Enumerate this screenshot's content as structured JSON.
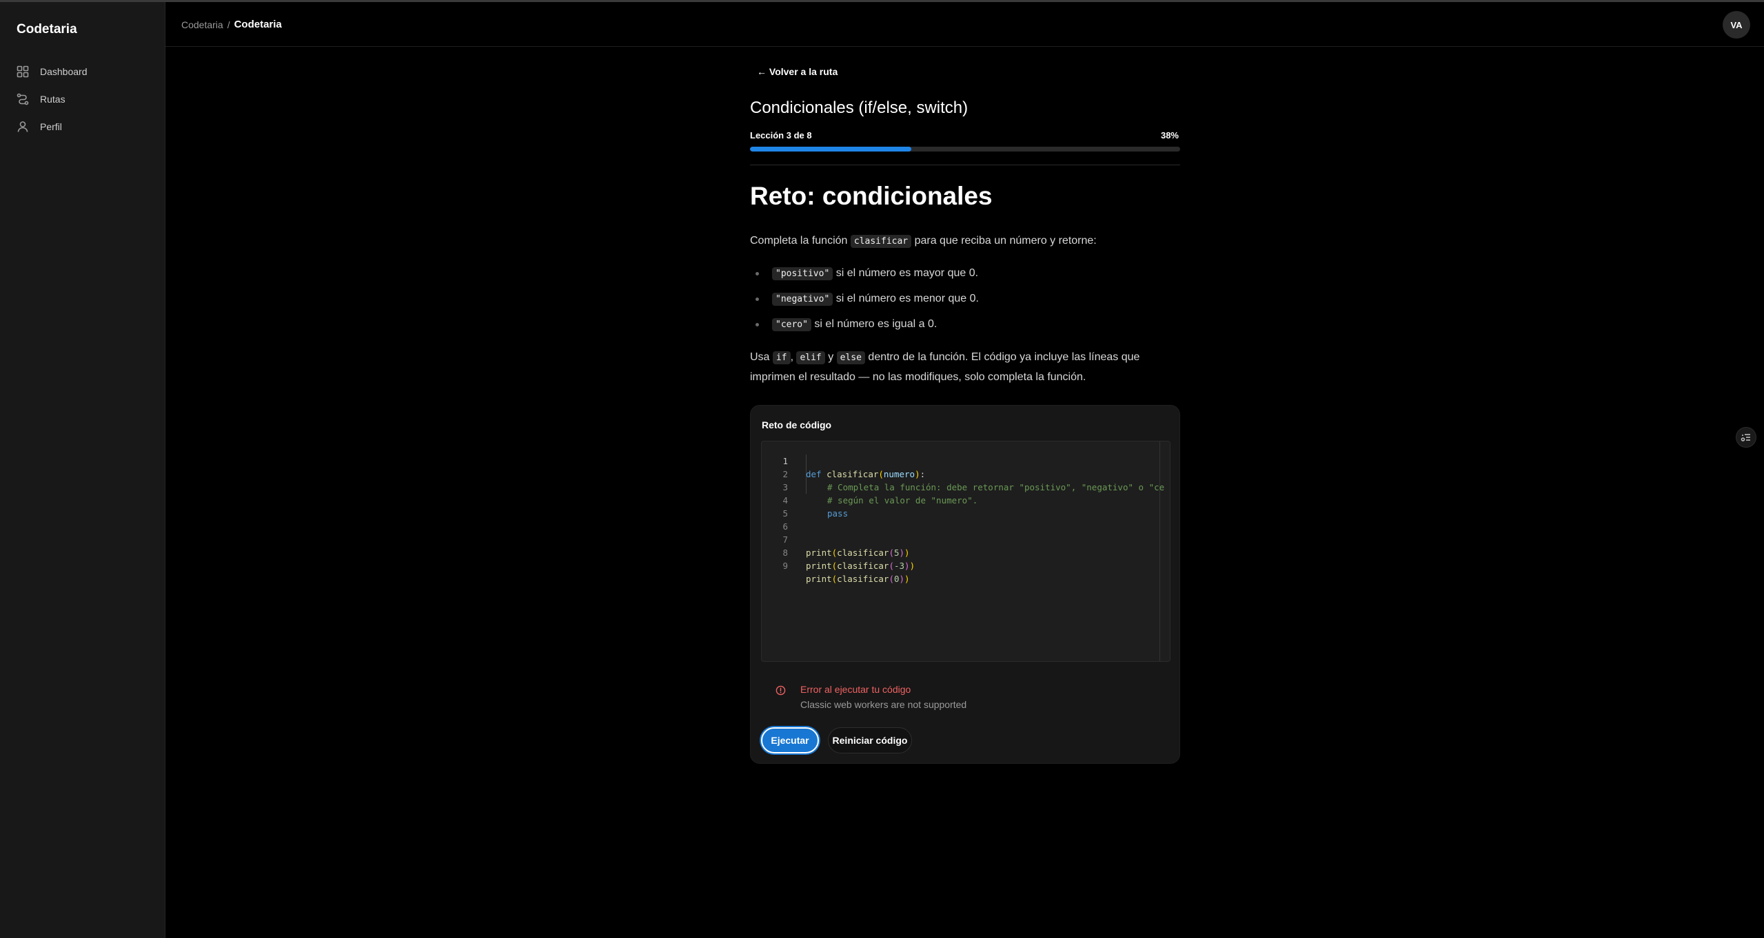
{
  "app": {
    "brand": "Codetaria"
  },
  "sidebar": {
    "items": [
      {
        "label": "Dashboard",
        "icon": "grid-icon"
      },
      {
        "label": "Rutas",
        "icon": "route-icon"
      },
      {
        "label": "Perfil",
        "icon": "user-icon"
      }
    ]
  },
  "header": {
    "breadcrumb": {
      "parent": "Codetaria",
      "separator": "/",
      "current": "Codetaria"
    },
    "avatar_initials": "VA"
  },
  "lesson": {
    "back_label": "← Volver a la ruta",
    "title": "Condicionales (if/else, switch)",
    "progress_label": "Lección 3 de 8",
    "progress_percent_label": "38%",
    "progress_fraction": 0.375
  },
  "content": {
    "heading": "Reto: condicionales",
    "intro": {
      "before": "Completa la función ",
      "code": "clasificar",
      "after": " para que reciba un número y retorne:"
    },
    "bullets": [
      {
        "code": "\"positivo\"",
        "text": " si el número es mayor que 0."
      },
      {
        "code": "\"negativo\"",
        "text": " si el número es menor que 0."
      },
      {
        "code": "\"cero\"",
        "text": " si el número es igual a 0."
      }
    ],
    "usage": {
      "t1": "Usa ",
      "c1": "if",
      "t2": ", ",
      "c2": "elif",
      "t3": " y ",
      "c3": "else",
      "t4": " dentro de la función. El código ya incluye las líneas que imprimen el resultado — no las modifiques, solo completa la función."
    }
  },
  "challenge": {
    "title": "Reto de código",
    "line_numbers": [
      "1",
      "2",
      "3",
      "4",
      "5",
      "6",
      "7",
      "8",
      "9"
    ],
    "code_tokens": {
      "l1_def": "def",
      "l1_fn": "clasificar",
      "l1_open": "(",
      "l1_arg": "numero",
      "l1_close": ")",
      "l1_colon": ":",
      "l2": "# Completa la función: debe retornar \"positivo\", \"negativo\" o \"ce",
      "l3": "# según el valor de \"numero\".",
      "l4": "pass",
      "print": "print",
      "clasificar": "clasificar",
      "open": "(",
      "close": ")",
      "arg7": "5",
      "arg8": "-3",
      "arg9": "0"
    },
    "error_title": "Error al ejecutar tu código",
    "error_message": "Classic web workers are not supported",
    "run_label": "Ejecutar",
    "reset_label": "Reiniciar código"
  },
  "colors": {
    "accent": "#1f86e8",
    "error": "#f06262",
    "background": "#000000",
    "sidebar": "#181818"
  }
}
